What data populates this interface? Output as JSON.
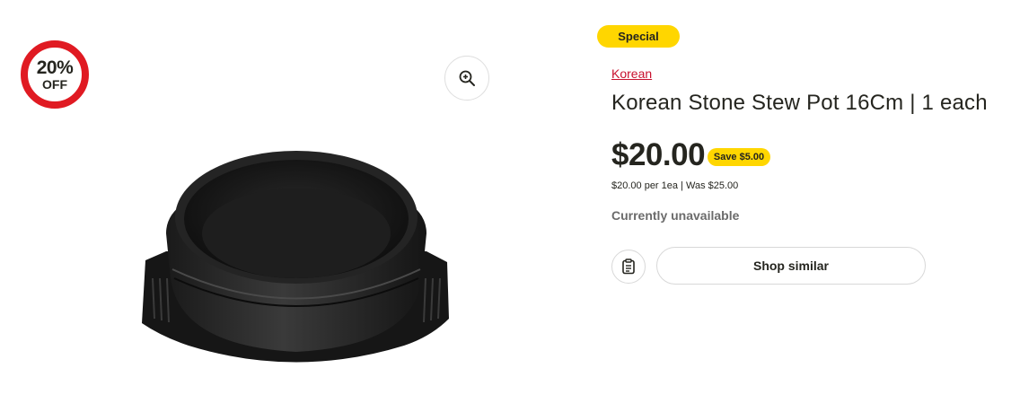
{
  "discount_badge": {
    "percent": "20%",
    "off_label": "OFF"
  },
  "image_tools": {
    "zoom_icon": "zoom-in-icon"
  },
  "product": {
    "special_label": "Special",
    "brand": "Korean",
    "title": "Korean Stone Stew Pot 16Cm | 1 each",
    "price": "$20.00",
    "save_label": "Save $5.00",
    "unit_price_line": "$20.00 per 1ea | Was $25.00",
    "availability": "Currently unavailable"
  },
  "actions": {
    "list_icon": "shopping-list-icon",
    "shop_similar_label": "Shop similar"
  },
  "colors": {
    "accent_yellow": "#ffd600",
    "badge_red": "#e01a22",
    "link_red": "#c8102e"
  }
}
